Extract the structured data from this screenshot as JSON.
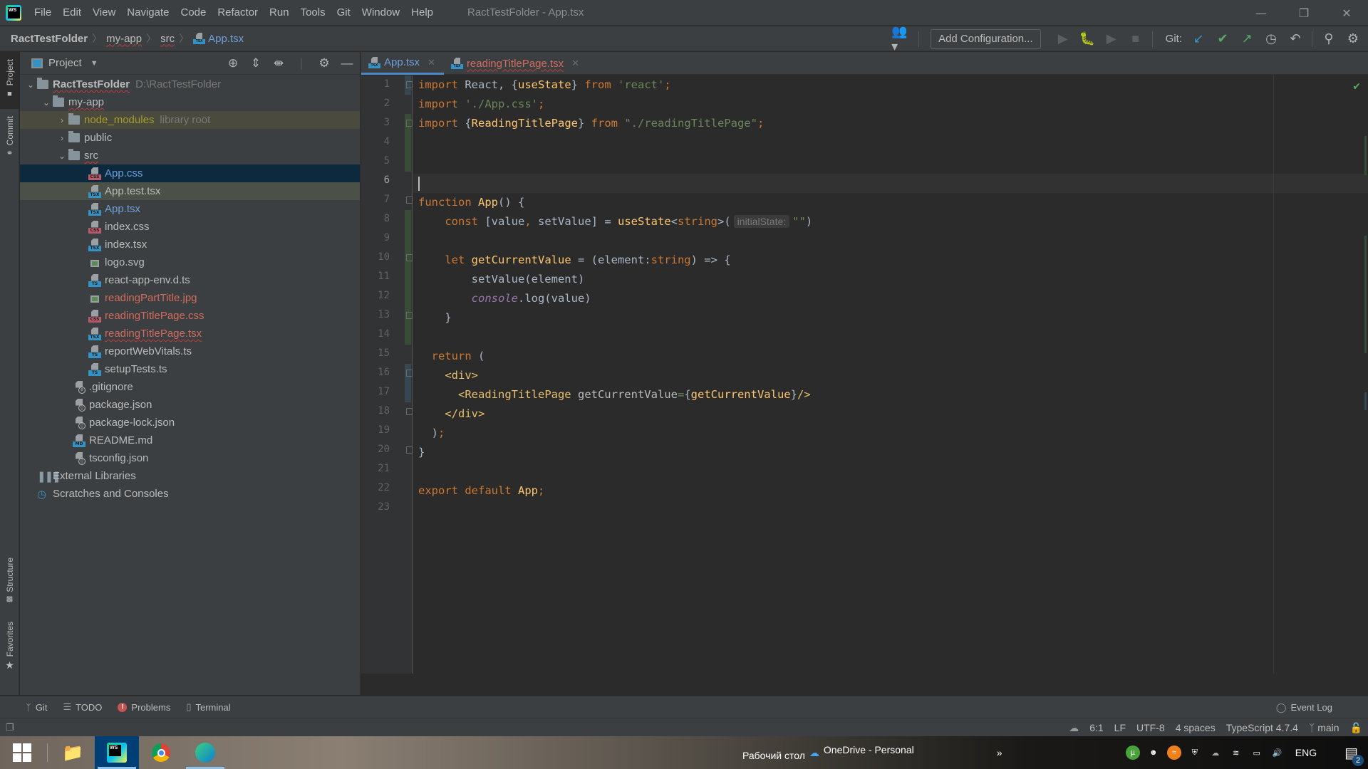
{
  "app": {
    "window_title": "RactTestFolder - App.tsx",
    "menu": [
      "File",
      "Edit",
      "View",
      "Navigate",
      "Code",
      "Refactor",
      "Run",
      "Tools",
      "Git",
      "Window",
      "Help"
    ]
  },
  "breadcrumb": [
    "RactTestFolder",
    "my-app",
    "src",
    "App.tsx"
  ],
  "toolbar": {
    "add_configuration": "Add Configuration...",
    "git_label": "Git:"
  },
  "side_tabs": {
    "project": "Project",
    "commit": "Commit",
    "structure": "Structure",
    "favorites": "Favorites"
  },
  "project_panel": {
    "title": "Project",
    "tree": [
      {
        "name": "RactTestFolder",
        "extra": "D:\\RactTestFolder",
        "type": "folder",
        "depth": 0,
        "state": "expanded"
      },
      {
        "name": "my-app",
        "type": "folder",
        "depth": 1,
        "state": "expanded"
      },
      {
        "name": "node_modules",
        "extra": "library root",
        "type": "folder",
        "depth": 2,
        "state": "collapsed"
      },
      {
        "name": "public",
        "type": "folder",
        "depth": 2,
        "state": "collapsed"
      },
      {
        "name": "src",
        "type": "folder",
        "depth": 2,
        "state": "expanded"
      },
      {
        "name": "App.css",
        "type": "css",
        "depth": 3
      },
      {
        "name": "App.test.tsx",
        "type": "tsx",
        "depth": 3
      },
      {
        "name": "App.tsx",
        "type": "tsx",
        "depth": 3
      },
      {
        "name": "index.css",
        "type": "css",
        "depth": 3
      },
      {
        "name": "index.tsx",
        "type": "tsx",
        "depth": 3
      },
      {
        "name": "logo.svg",
        "type": "image",
        "depth": 3
      },
      {
        "name": "react-app-env.d.ts",
        "type": "ts",
        "depth": 3
      },
      {
        "name": "readingPartTitle.jpg",
        "type": "image",
        "depth": 3
      },
      {
        "name": "readingTitlePage.css",
        "type": "css",
        "depth": 3
      },
      {
        "name": "readingTitlePage.tsx",
        "type": "tsx",
        "depth": 3
      },
      {
        "name": "reportWebVitals.ts",
        "type": "ts",
        "depth": 3
      },
      {
        "name": "setupTests.ts",
        "type": "ts",
        "depth": 3
      },
      {
        "name": ".gitignore",
        "type": "ignore",
        "depth": 2
      },
      {
        "name": "package.json",
        "type": "json",
        "depth": 2
      },
      {
        "name": "package-lock.json",
        "type": "json",
        "depth": 2
      },
      {
        "name": "README.md",
        "type": "md",
        "depth": 2
      },
      {
        "name": "tsconfig.json",
        "type": "json",
        "depth": 2
      },
      {
        "name": "External Libraries",
        "type": "libraries",
        "depth": 0
      },
      {
        "name": "Scratches and Consoles",
        "type": "scratches",
        "depth": 0
      }
    ]
  },
  "editor": {
    "tabs": [
      {
        "label": "App.tsx",
        "active": true
      },
      {
        "label": "readingTitlePage.tsx",
        "active": false
      }
    ],
    "current_line": 6,
    "inlay_hint": "initialState:",
    "lines": [
      "import React, {useState} from 'react';",
      "import './App.css';",
      "import {ReadingTitlePage} from \"./readingTitlePage\";",
      "",
      "",
      "",
      "function App() {",
      "    const [value, setValue] = useState<string>(\"\")",
      "",
      "    let getCurrentValue = (element:string) => {",
      "        setValue(element)",
      "        console.log(value)",
      "    }",
      "",
      "  return (",
      "    <div>",
      "      <ReadingTitlePage getCurrentValue={getCurrentValue}/>",
      "    </div>",
      "  );",
      "}",
      "",
      "export default App;",
      ""
    ]
  },
  "bottom_tabs": {
    "git": "Git",
    "todo": "TODO",
    "problems": "Problems",
    "terminal": "Terminal",
    "event_log": "Event Log"
  },
  "status_bar": {
    "position": "6:1",
    "line_separator": "LF",
    "encoding": "UTF-8",
    "indent": "4 spaces",
    "language": "TypeScript 4.7.4",
    "branch": "main"
  },
  "taskbar": {
    "desktop_label": "Рабочий стол",
    "onedrive_label": "OneDrive - Personal",
    "language": "ENG",
    "notification_count": "2"
  },
  "colors": {
    "accent": "#4a88c7",
    "keyword": "#cc7832",
    "string": "#6a8759",
    "function": "#ffc66d",
    "modified_file": "#6f9fd8",
    "unversioned_file": "#d06c5e"
  }
}
